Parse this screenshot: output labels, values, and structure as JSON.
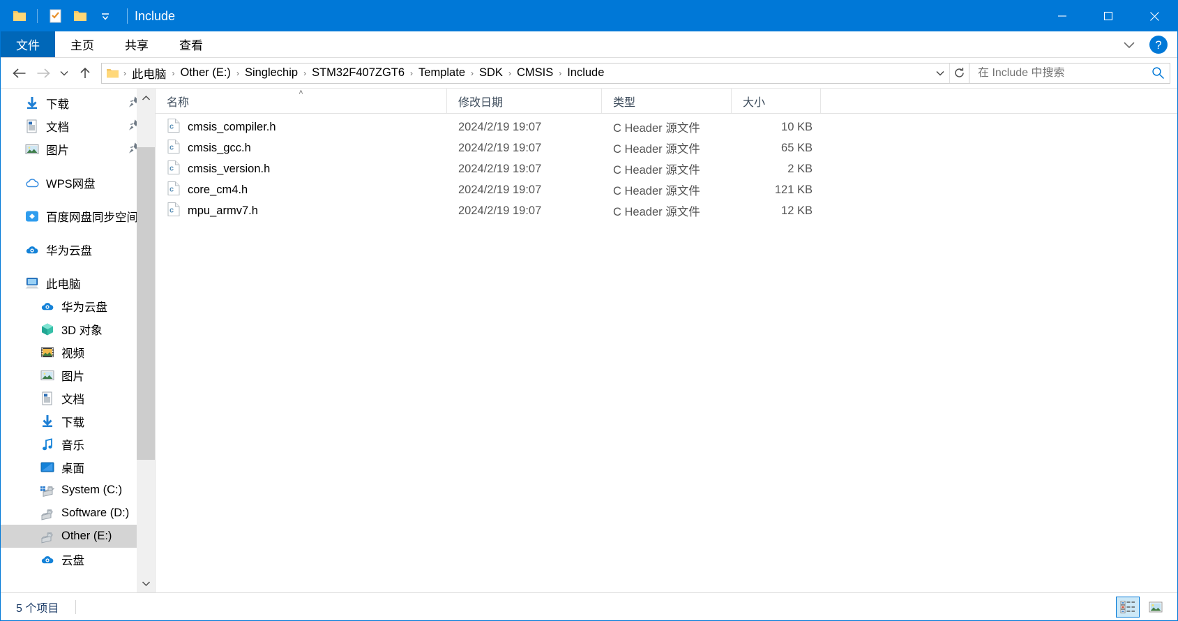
{
  "window": {
    "title": "Include",
    "quick_access": [
      "folder-icon",
      "properties-checklist-icon",
      "new-folder-icon",
      "customize-dropdown-icon"
    ],
    "controls": {
      "minimize": "—",
      "maximize": "☐",
      "close": "✕"
    }
  },
  "ribbon": {
    "file_tab": "文件",
    "tabs": [
      "主页",
      "共享",
      "查看"
    ],
    "collapse_icon": "chevron-down-icon",
    "help_icon": "help-icon"
  },
  "address": {
    "back_icon": "back-arrow-icon",
    "forward_icon": "forward-arrow-icon",
    "recent_icon": "recent-locations-chevron-icon",
    "up_icon": "up-arrow-icon",
    "breadcrumbs": [
      "此电脑",
      "Other (E:)",
      "Singlechip",
      "STM32F407ZGT6",
      "Template",
      "SDK",
      "CMSIS",
      "Include"
    ],
    "separator": "›",
    "dropdown_icon": "chevron-down-icon",
    "refresh_icon": "refresh-icon"
  },
  "search": {
    "placeholder": "在 Include 中搜索",
    "value": "",
    "icon": "search-icon"
  },
  "sidebar": {
    "groups": [
      {
        "items": [
          {
            "label": "下载",
            "icon": "download-icon",
            "level": 0,
            "pinned": true,
            "selected": false
          },
          {
            "label": "文档",
            "icon": "documents-icon",
            "level": 0,
            "pinned": true,
            "selected": false
          },
          {
            "label": "图片",
            "icon": "pictures-icon",
            "level": 0,
            "pinned": true,
            "selected": false
          }
        ]
      },
      {
        "items": [
          {
            "label": "WPS网盘",
            "icon": "wps-cloud-icon",
            "level": 0,
            "pinned": false,
            "selected": false
          }
        ]
      },
      {
        "items": [
          {
            "label": "百度网盘同步空间",
            "icon": "baidu-netdisk-icon",
            "level": 0,
            "pinned": false,
            "selected": false
          }
        ]
      },
      {
        "items": [
          {
            "label": "华为云盘",
            "icon": "huawei-cloud-icon",
            "level": 0,
            "pinned": false,
            "selected": false
          }
        ]
      },
      {
        "items": [
          {
            "label": "此电脑",
            "icon": "this-pc-icon",
            "level": 0,
            "pinned": false,
            "selected": false
          },
          {
            "label": "华为云盘",
            "icon": "huawei-cloud-icon",
            "level": 1,
            "pinned": false,
            "selected": false
          },
          {
            "label": "3D 对象",
            "icon": "3d-objects-icon",
            "level": 1,
            "pinned": false,
            "selected": false
          },
          {
            "label": "视频",
            "icon": "videos-icon",
            "level": 1,
            "pinned": false,
            "selected": false
          },
          {
            "label": "图片",
            "icon": "pictures-icon",
            "level": 1,
            "pinned": false,
            "selected": false
          },
          {
            "label": "文档",
            "icon": "documents-icon",
            "level": 1,
            "pinned": false,
            "selected": false
          },
          {
            "label": "下载",
            "icon": "download-icon",
            "level": 1,
            "pinned": false,
            "selected": false
          },
          {
            "label": "音乐",
            "icon": "music-icon",
            "level": 1,
            "pinned": false,
            "selected": false
          },
          {
            "label": "桌面",
            "icon": "desktop-icon",
            "level": 1,
            "pinned": false,
            "selected": false
          },
          {
            "label": "System (C:)",
            "icon": "system-drive-icon",
            "level": 1,
            "pinned": false,
            "selected": false
          },
          {
            "label": "Software (D:)",
            "icon": "drive-icon",
            "level": 1,
            "pinned": false,
            "selected": false
          },
          {
            "label": "Other (E:)",
            "icon": "drive-icon",
            "level": 1,
            "pinned": false,
            "selected": true
          },
          {
            "label": "云盘",
            "icon": "huawei-cloud-icon",
            "level": 1,
            "pinned": false,
            "selected": false
          }
        ]
      }
    ],
    "scroll_up_icon": "chevron-up-icon",
    "scroll_down_icon": "chevron-down-icon"
  },
  "filelist": {
    "columns": [
      {
        "label": "名称",
        "sorted": "asc"
      },
      {
        "label": "修改日期",
        "sorted": ""
      },
      {
        "label": "类型",
        "sorted": ""
      },
      {
        "label": "大小",
        "sorted": ""
      }
    ],
    "sort_ascending_glyph": "˄",
    "rows": [
      {
        "name": "cmsis_compiler.h",
        "icon": "c-header-file-icon",
        "date": "2024/2/19 19:07",
        "type": "C Header 源文件",
        "size": "10 KB"
      },
      {
        "name": "cmsis_gcc.h",
        "icon": "c-header-file-icon",
        "date": "2024/2/19 19:07",
        "type": "C Header 源文件",
        "size": "65 KB"
      },
      {
        "name": "cmsis_version.h",
        "icon": "c-header-file-icon",
        "date": "2024/2/19 19:07",
        "type": "C Header 源文件",
        "size": "2 KB"
      },
      {
        "name": "core_cm4.h",
        "icon": "c-header-file-icon",
        "date": "2024/2/19 19:07",
        "type": "C Header 源文件",
        "size": "121 KB"
      },
      {
        "name": "mpu_armv7.h",
        "icon": "c-header-file-icon",
        "date": "2024/2/19 19:07",
        "type": "C Header 源文件",
        "size": "12 KB"
      }
    ]
  },
  "statusbar": {
    "item_count": "5 个项目",
    "details_view_icon": "details-view-icon",
    "large_icons_view_icon": "large-icons-view-icon",
    "active_view": "details"
  },
  "colors": {
    "accent": "#0078d7",
    "file_tab": "#0067b8",
    "selection": "#d4d4d4",
    "hover": "#e5f1fb"
  }
}
